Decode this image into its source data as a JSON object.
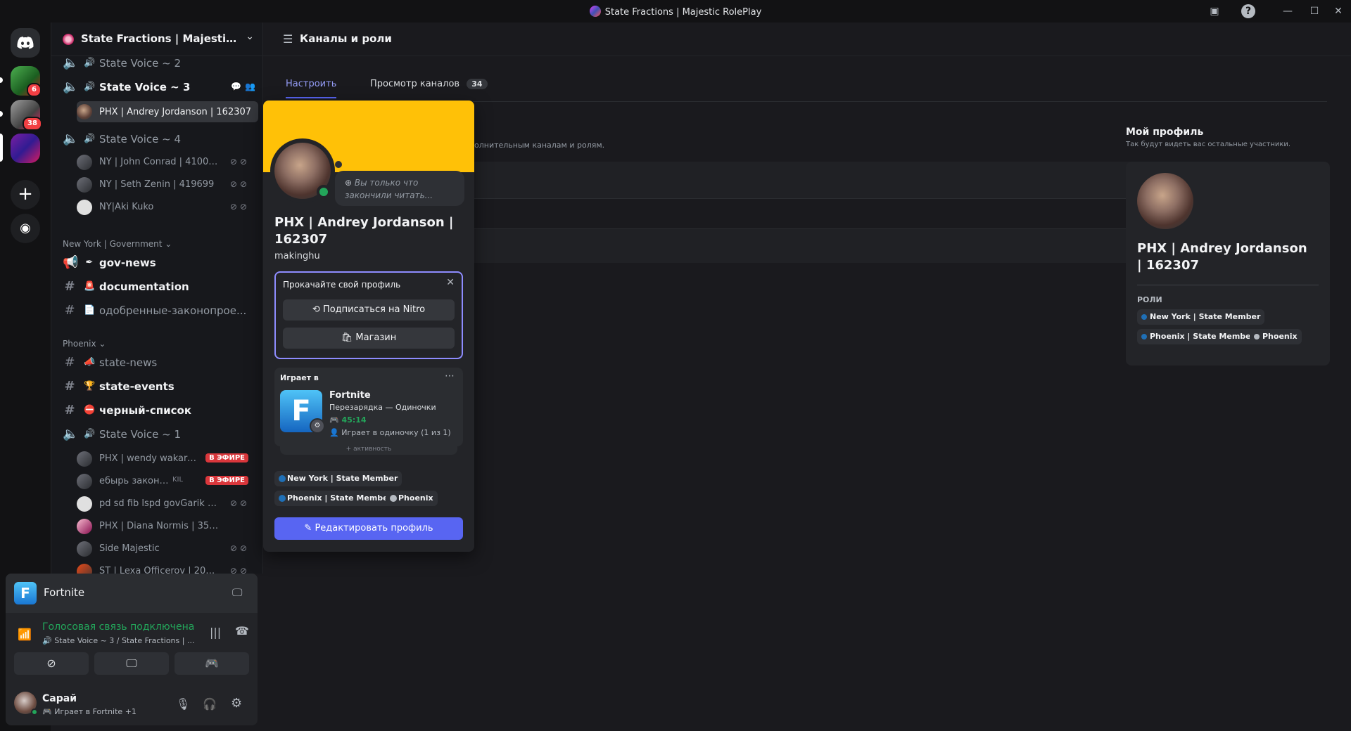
{
  "window": {
    "title": "State Fractions | Majestic RolePlay"
  },
  "rail": {
    "badges": [
      "6",
      "38"
    ]
  },
  "guild": {
    "name": "State Fractions | Majestic Role..."
  },
  "channels": {
    "voice2": "State Voice ~ 2",
    "voice3": "State Voice ~ 3",
    "voice3_user": "PHX | Andrey Jordanson | 162307",
    "voice4": "State Voice ~ 4",
    "voice4_users": [
      "NY | John Conrad | 410089",
      "NY | Seth Zenin | 419699",
      "NY|Aki Kuko"
    ],
    "cat_ny": "New York | Government",
    "gov_news": "gov-news",
    "documentation": "documentation",
    "approved": "одобренные-законопрое...",
    "cat_phx": "Phoenix",
    "state_news": "state-news",
    "state_events": "state-events",
    "blacklist": "черный-список",
    "voice1": "State Voice ~ 1",
    "voice1_users": [
      "PHX | wendy wakare...",
      "ебырь законки",
      "pd sd fib lspd govGarik Fr...",
      "PHX | Diana Normis | 35059",
      "Side Majestic",
      "ST | Lexa Officerov | 202..."
    ],
    "live_label": "В ЭФИРЕ",
    "kill_tag": "KIL"
  },
  "bottom": {
    "game": "Fortnite",
    "voice_status": "Голосовая связь подключена",
    "voice_channel": "State Voice ~ 3 / State Fractions | ...",
    "username": "Сарай",
    "user_activity": "Играет в Fortnite +1"
  },
  "main": {
    "header": "Каналы и роли",
    "tab_customize": "Настроить",
    "tab_browse": "Просмотр каналов",
    "tab_browse_count": "34",
    "card_subtitle": "олнительным каналам и ролям.",
    "my_profile_title": "Мой профиль",
    "my_profile_subtitle": "Так будут видеть вас остальные участники.",
    "profile_name": "PHX | Andrey Jordanson | 162307",
    "roles_label": "РОЛИ",
    "roles": [
      "New York | State Member",
      "Phoenix | State Member",
      "Phoenix"
    ]
  },
  "popout": {
    "status_placeholder": "Вы только что закончили читать...",
    "display_name": "PHX | Andrey Jordanson | 162307",
    "username": "makinghu",
    "nitro_title": "Прокачайте свой профиль",
    "nitro_button": "Подписаться на Nitro",
    "shop_button": "Магазин",
    "activity_header": "Играет в",
    "game_name": "Fortnite",
    "game_state": "Перезарядка — Одиночки",
    "game_time": "45:14",
    "game_party": "Играет в одиночку (1 из 1)",
    "activity_more": "+ активность",
    "roles": [
      "New York | State Member",
      "Phoenix | State Member",
      "Phoenix"
    ],
    "edit_button": "Редактировать профиль"
  },
  "colors": {
    "accent": "#5865f2",
    "banner": "#ffc107",
    "online": "#23a55a",
    "live": "#da373c",
    "role_blue": "#1f6fb5",
    "role_grey": "#b5bac1"
  }
}
